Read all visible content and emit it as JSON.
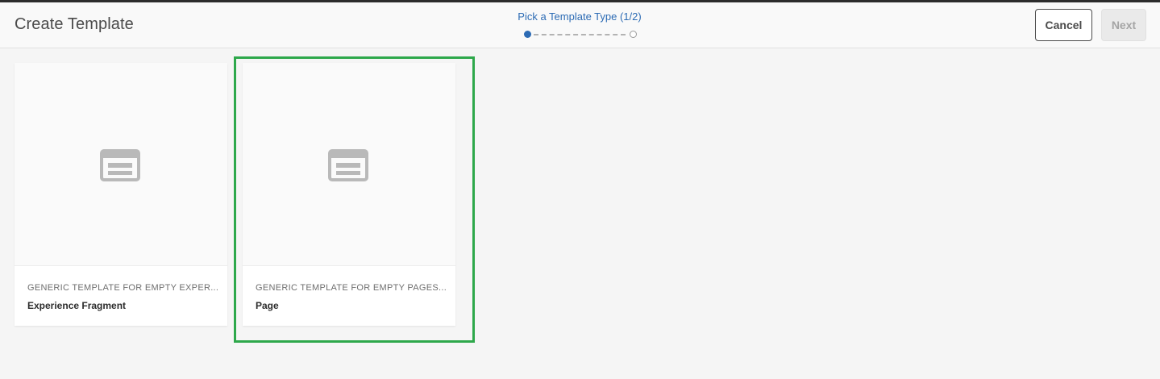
{
  "header": {
    "title": "Create Template",
    "wizard_label": "Pick a Template Type (1/2)",
    "cancel_label": "Cancel",
    "next_label": "Next"
  },
  "cards": [
    {
      "description": "GENERIC TEMPLATE FOR EMPTY EXPER...",
      "name": "Experience Fragment",
      "icon": "template-placeholder-icon"
    },
    {
      "description": "GENERIC TEMPLATE FOR EMPTY PAGES...",
      "name": "Page",
      "icon": "template-placeholder-icon"
    }
  ],
  "colors": {
    "accent": "#2c6bb4",
    "highlight": "#2ea84b"
  }
}
